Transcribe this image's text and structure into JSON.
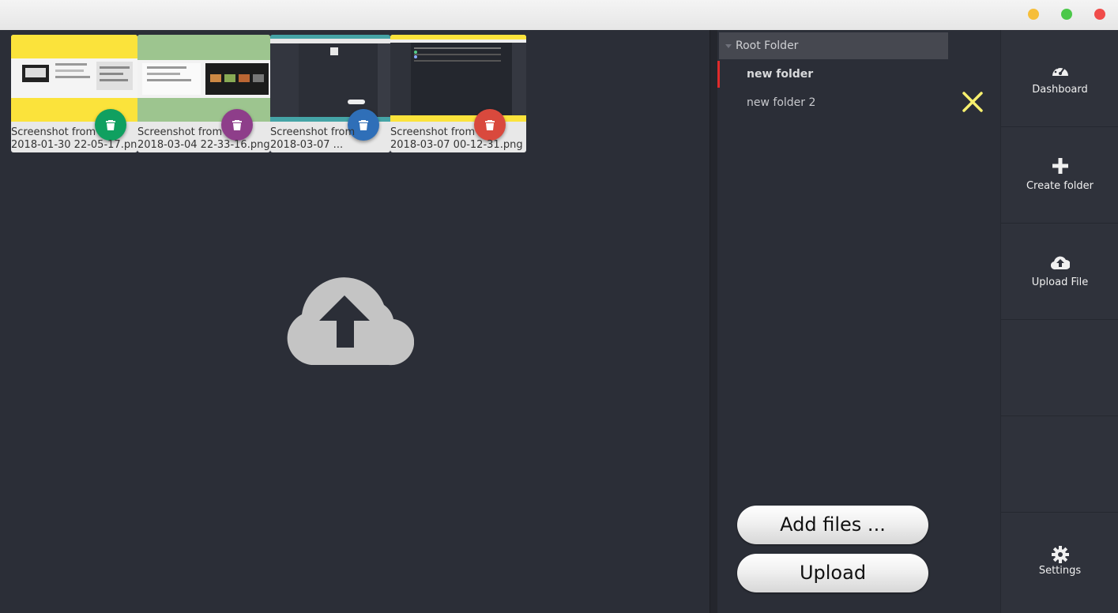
{
  "files": [
    {
      "caption": "Screenshot from\n2018-01-30 22-05-17.pn",
      "accent": "#fbe33b",
      "button_color": "#10a060"
    },
    {
      "caption": "Screenshot from\n2018-03-04 22-33-16.png",
      "accent": "#9dc58f",
      "button_color": "#8e3e8a"
    },
    {
      "caption": "Screenshot from\n2018-03-07 ...",
      "accent": "#45a4a6",
      "button_color": "#2f6fb8"
    },
    {
      "caption": "Screenshot from\n2018-03-07 00-12-31.png",
      "accent": "#fbe33b",
      "button_color": "#d9493d"
    }
  ],
  "folder_tree": {
    "root": "Root Folder",
    "folders": [
      "new folder",
      "new folder 2"
    ],
    "active": "new folder"
  },
  "actions": {
    "add_files": "Add files ...",
    "upload": "Upload"
  },
  "nav": {
    "dashboard": "Dashboard",
    "create_folder": "Create folder",
    "upload_file": "Upload File",
    "settings": "Settings"
  },
  "colors": {
    "background": "#2b2e37",
    "close_accent": "#f7f06e",
    "active_marker": "#e02b2b"
  }
}
